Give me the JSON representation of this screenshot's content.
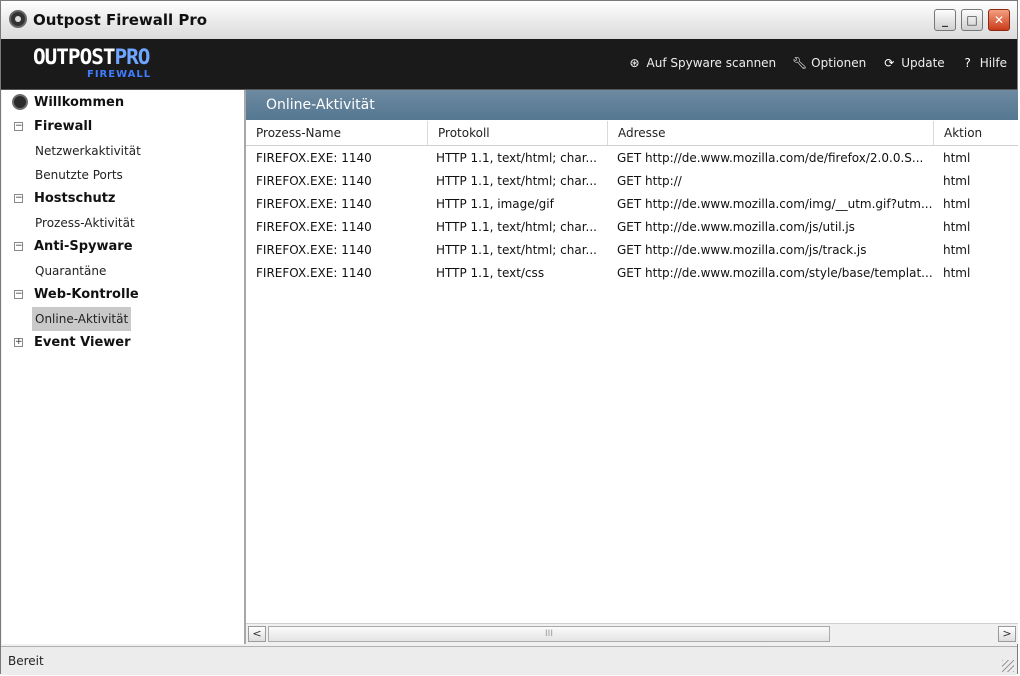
{
  "window": {
    "title": "Outpost Firewall Pro",
    "min_glyph": "_",
    "max_glyph": "□",
    "close_glyph": "✕"
  },
  "brand": {
    "logo_main": "OUTPOST",
    "logo_pro": "PRO",
    "logo_sub": "FIREWALL"
  },
  "topmenu": {
    "scan": "Auf Spyware scannen",
    "options": "Optionen",
    "update": "Update",
    "help": "Hilfe"
  },
  "sidebar": {
    "willkommen": "Willkommen",
    "firewall": "Firewall",
    "netzwerk": "Netzwerkaktivität",
    "ports": "Benutzte Ports",
    "hostschutz": "Hostschutz",
    "prozess": "Prozess-Aktivität",
    "antispyware": "Anti-Spyware",
    "quarantaene": "Quarantäne",
    "webkontrolle": "Web-Kontrolle",
    "online": "Online-Aktivität",
    "eventviewer": "Event Viewer",
    "collapse_glyph": "−",
    "expand_glyph": "+"
  },
  "panel": {
    "title": "Online-Aktivität",
    "columns": [
      "Prozess-Name",
      "Protokoll",
      "Adresse",
      "Aktion"
    ],
    "rows": [
      [
        "FIREFOX.EXE: 1140",
        "HTTP 1.1, text/html; char...",
        "GET http://de.www.mozilla.com/de/firefox/2.0.0.S...",
        "html"
      ],
      [
        "FIREFOX.EXE: 1140",
        "HTTP 1.1, text/html; char...",
        "GET http://",
        "html"
      ],
      [
        "FIREFOX.EXE: 1140",
        "HTTP 1.1, image/gif",
        "GET http://de.www.mozilla.com/img/__utm.gif?utm...",
        "html"
      ],
      [
        "FIREFOX.EXE: 1140",
        "HTTP 1.1, text/html; char...",
        "GET http://de.www.mozilla.com/js/util.js",
        "html"
      ],
      [
        "FIREFOX.EXE: 1140",
        "HTTP 1.1, text/html; char...",
        "GET http://de.www.mozilla.com/js/track.js",
        "html"
      ],
      [
        "FIREFOX.EXE: 1140",
        "HTTP 1.1, text/css",
        "GET http://de.www.mozilla.com/style/base/templat...",
        "html"
      ]
    ],
    "scroll_left": "<",
    "scroll_right": ">",
    "scroll_grip": "III"
  },
  "status": {
    "text": "Bereit"
  }
}
